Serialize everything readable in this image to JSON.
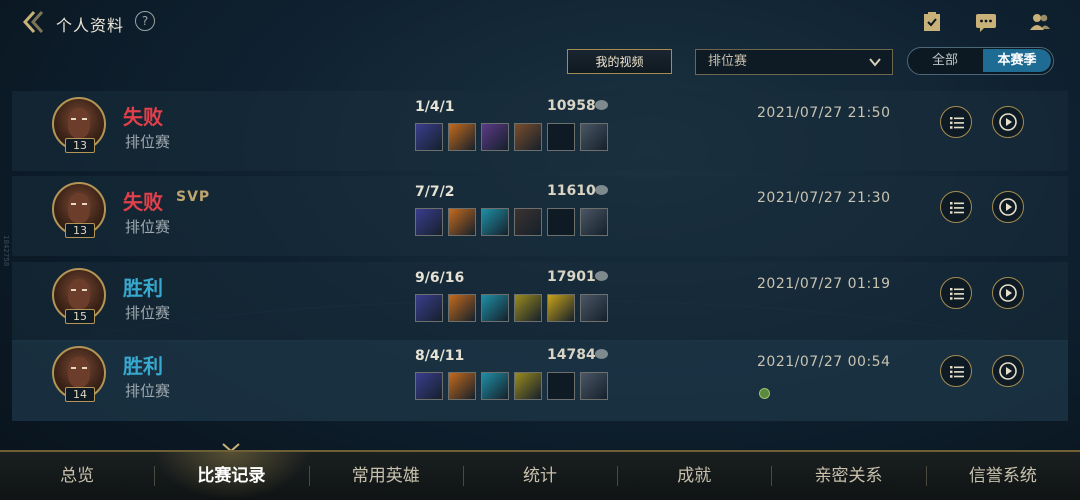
{
  "header": {
    "title": "个人资料",
    "help_label": "?",
    "icons": [
      "back-chevron-icon",
      "help-icon",
      "checklist-icon",
      "chat-icon",
      "friends-icon"
    ]
  },
  "controls": {
    "video_button": "我的视频",
    "mode_select": "排位赛",
    "segment_all": "全部",
    "segment_season": "本赛季",
    "accent": "#1e6c93"
  },
  "side_text": "1842758",
  "matches": [
    {
      "result": "失败",
      "result_type": "lose",
      "svp": "",
      "mode": "排位赛",
      "level": "13",
      "kda": "1/4/1",
      "score": "10958",
      "time": "2021/07/27 21:50",
      "items": [
        "#3a3e8e",
        "#c46a1c",
        "#5b3a86",
        "#7a4d2c",
        "empty",
        "#4a5665"
      ]
    },
    {
      "result": "失败",
      "result_type": "lose",
      "svp": "SVP",
      "mode": "排位赛",
      "level": "13",
      "kda": "7/7/2",
      "score": "11610",
      "time": "2021/07/27 21:30",
      "items": [
        "#3a3e8e",
        "#c46a1c",
        "#1f8fa5",
        "#3b3330",
        "empty",
        "#4a5665"
      ]
    },
    {
      "result": "胜利",
      "result_type": "win",
      "svp": "",
      "mode": "排位赛",
      "level": "15",
      "kda": "9/6/16",
      "score": "17901",
      "time": "2021/07/27 01:19",
      "items": [
        "#3a3e8e",
        "#c46a1c",
        "#1f8fa5",
        "#9a8a1f",
        "#c8a21a",
        "#4a5665"
      ]
    },
    {
      "result": "胜利",
      "result_type": "win",
      "svp": "",
      "mode": "排位赛",
      "level": "14",
      "kda": "8/4/11",
      "score": "14784",
      "time": "2021/07/27 00:54",
      "items": [
        "#3a3e8e",
        "#c46a1c",
        "#1f8fa5",
        "#9a8a1f",
        "empty",
        "#4a5665"
      ]
    }
  ],
  "tabs": [
    {
      "label": "总览",
      "active": false
    },
    {
      "label": "比赛记录",
      "active": true
    },
    {
      "label": "常用英雄",
      "active": false
    },
    {
      "label": "统计",
      "active": false
    },
    {
      "label": "成就",
      "active": false
    },
    {
      "label": "亲密关系",
      "active": false
    },
    {
      "label": "信誉系统",
      "active": false
    }
  ]
}
